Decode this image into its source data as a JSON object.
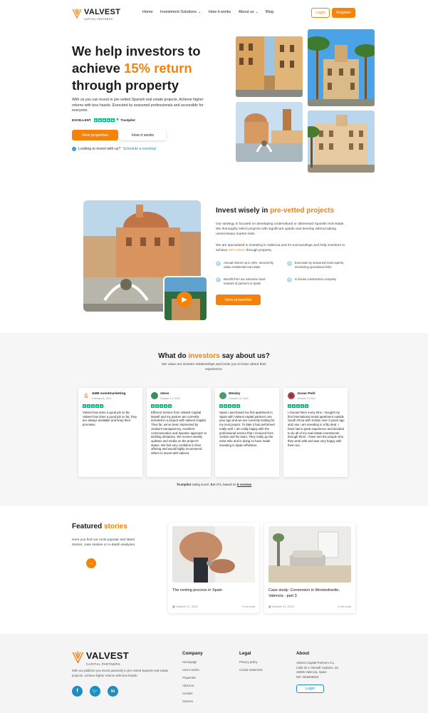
{
  "brand": {
    "name": "VALVEST",
    "tagline": "CAPITAL PARTNERS"
  },
  "nav": {
    "items": [
      "Home",
      "Investment Solutions",
      "How it works",
      "About us",
      "Blog"
    ],
    "login": "Login",
    "register": "Register"
  },
  "hero": {
    "title_a": "We help investors to",
    "title_b": "achieve ",
    "title_highlight": "15% return",
    "title_c": "through property",
    "description": "With us you can invest in pre-vetted Spanish real estate projects. Achieve higher returns with less hassle. Executed by seasoned professionals and accessible for everyone.",
    "trust_label": "EXCELLENT",
    "trust_brand": "Trustpilot",
    "cta_primary": "View properties",
    "cta_secondary": "How it works",
    "meeting_text": "Looking to invest with us?",
    "meeting_link": "Schedule a meeting!"
  },
  "invest": {
    "title": "Invest wisely in ",
    "title_highlight": "pre-vetted projects",
    "p1": "Our strategy is focused on developing undervalued or distressed Spanish real estate. We thoroughly select projects with significant upside and develop without taking unnecessary market risks.",
    "p2_a": "We are specialized in investing in Valencia and it's surroundings and help investors to achieve ",
    "p2_highlight": "15% return",
    "p2_b": " through property.",
    "features": [
      "Annual returns up to 15%, secured by urban residential real estate",
      "Execution by seasoned local experts, minimizing operational risks",
      "Benefit from our extensive local network of partners in Spain",
      "In-house construction company"
    ],
    "cta": "View properties"
  },
  "testimonials": {
    "title_a": "What do ",
    "title_highlight": "investors",
    "title_b": " say about us?",
    "subtitle": "We value our investor relationships and invite you to learn about their experience.",
    "reviews": [
      {
        "name": "&ME eventmarketing",
        "date": "February 8, 2023",
        "text": "Valvest has done a good job so far. Valvest has done a good job so far, they are always available and keep their promises."
      },
      {
        "name": "steve",
        "date": "October 10, 2022",
        "text": "Efficient Service from Valvest Capital Myself and my partner are currently invested in a project with Valvest Capital. Thus far, we've been impressed by Jordan's transparency, excellent communication and dynamic approach to tackling obstacles. We receive weekly updates and media on the project's status. We feel very confident in their offering and would highly recommend others to invest with Valvest."
      },
      {
        "name": "Wesley",
        "date": "October 10, 2022",
        "text": "Spain I purchased my first apartment in Spain with Valvest capital partners one year ago and we are currently looking for my next project. To date it has performed really well. I am really happy with the professional service that I received from Jordan and his team. They really go the extra mile and in doing so have made investing in Spain effortless."
      },
      {
        "name": "Jovan Pohl",
        "date": "October 3, 2022",
        "text": "I choose them every time. I bought my first international rental apartment outside South Africa with Jordan over 3 years ago and now I am investing in a flip deal. I have had a great experience and decided to do all of my real-estate investments through them. I have met the people who they work with and was very happy with them too."
      }
    ],
    "rating_brand": "Trustpilot",
    "rating_text_a": " rating score: ",
    "rating_score": "5.0",
    "rating_text_b": " of 5, based on ",
    "rating_count": "5 reviews"
  },
  "stories": {
    "title": "Featured ",
    "title_highlight": "stories",
    "description": "Here you find our most popular and latest stories, case studies or in-depth analyses.",
    "items": [
      {
        "title": "The renting process in Spain",
        "date": "October 21, 2022",
        "read": "7 min read"
      },
      {
        "title": "Case study: Conversion in Monteolivette, Valencia - part 3",
        "date": "October 21, 2022",
        "read": "2 min read"
      }
    ]
  },
  "footer": {
    "description": "With our platform you invest passively in pre-vetted Spanish real estate projects. Achieve higher returns with less hassle.",
    "company_title": "Company",
    "company_links": [
      "Homepage",
      "How it works",
      "Properties",
      "About us",
      "Contact",
      "Careers"
    ],
    "legal_title": "Legal",
    "legal_links": [
      "Privacy policy",
      "Cookie statement"
    ],
    "about_title": "About",
    "about_lines": [
      "Valvest Capital Partners S.L.",
      "Calle de L'Almirall Cadarso, 26",
      "46005 Valencia, Spain",
      "NIF: B09658493"
    ],
    "login": "Login"
  },
  "colors": {
    "accent": "#f5820a",
    "trustpilot": "#00b67a",
    "social": "#1b8fbf"
  }
}
